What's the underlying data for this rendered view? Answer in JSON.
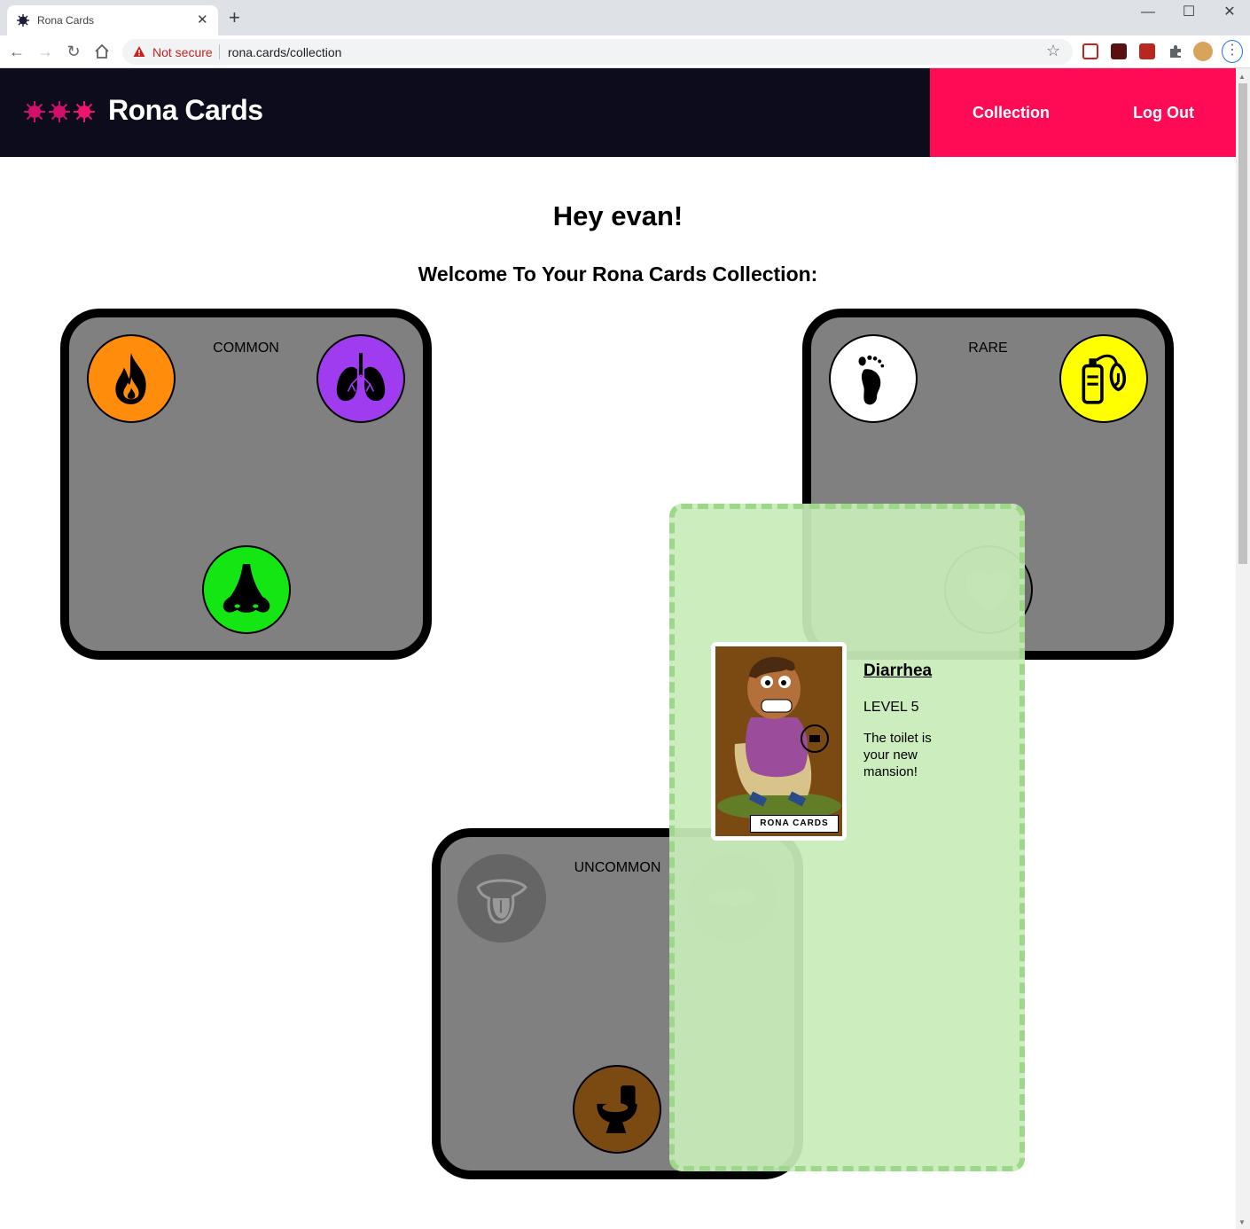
{
  "browser": {
    "tab_title": "Rona Cards",
    "tab_close": "✕",
    "new_tab": "+",
    "security_label": "Not secure",
    "url": "rona.cards/collection",
    "window_controls": {
      "minimize": "—",
      "maximize": "☐",
      "close": "✕"
    }
  },
  "header": {
    "brand": "Rona Cards",
    "nav": {
      "collection": "Collection",
      "logout": "Log Out"
    },
    "colors": {
      "background": "#0c0c1c",
      "nav_background": "#ff0a54",
      "logo_virus": "#d0106a"
    }
  },
  "page": {
    "greeting": "Hey evan!",
    "welcome": "Welcome To Your Rona Cards Collection:"
  },
  "packs": [
    {
      "label": "COMMON",
      "tokens": [
        {
          "icon": "fire-icon",
          "color": "#ff8c0a"
        },
        {
          "icon": "lungs-icon",
          "color": "#a03cf0"
        },
        {
          "icon": "nose-icon",
          "color": "#14e614"
        }
      ]
    },
    {
      "label": "RARE",
      "tokens": [
        {
          "icon": "foot-icon",
          "color": "#ffffff"
        },
        {
          "icon": "oxygen-tank-icon",
          "color": "#ffff00"
        },
        {
          "icon": "heart-icon",
          "color": "#6e6e6e"
        }
      ]
    },
    {
      "label": "UNCOMMON",
      "tokens": [
        {
          "icon": "tongue-icon",
          "color": "#656565"
        },
        {
          "icon": "lips-icon",
          "color": "#6e6e6e"
        },
        {
          "icon": "toilet-icon",
          "color": "#7a4a12"
        }
      ]
    }
  ],
  "selected_card": {
    "name": "Diarrhea",
    "level": "LEVEL 5",
    "description": "The toilet is your new mansion!",
    "card_brand": "RONA CARDS",
    "illustration": "man-on-toilet-illustration"
  }
}
